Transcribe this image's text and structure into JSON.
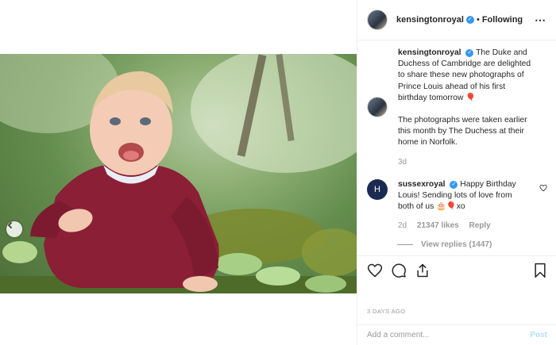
{
  "header": {
    "username": "kensingtonroyal",
    "verified_mark": "✓",
    "separator": "•",
    "follow_state": "Following",
    "more_label": "⋯"
  },
  "caption": {
    "username": "kensingtonroyal",
    "text1": "The Duke and Duchess of Cambridge are delighted to share these new photographs of Prince Louis ahead of his first birthday tomorrow",
    "emoji1": "🎈",
    "text2": "The photographs were taken earlier this month by The Duchess at their home in Norfolk.",
    "age": "3d"
  },
  "reply": {
    "username": "sussexroyal",
    "avatar_letter": "H",
    "text": "Happy Birthday Louis! Sending lots of love from both of us",
    "emoji": "🎂🎈",
    "suffix": "xo",
    "age": "2d",
    "likes": "21347 likes",
    "reply_label": "Reply",
    "view_replies": "View replies (1447)"
  },
  "actions": {
    "like_icon": "heart-icon",
    "comment_icon": "comment-icon",
    "share_icon": "share-icon",
    "save_icon": "bookmark-icon"
  },
  "date_ago": "3 DAYS AGO",
  "add_comment": {
    "placeholder": "Add a comment...",
    "post_label": "Post"
  },
  "colors": {
    "verified": "#3897f0",
    "muted": "#999999",
    "post_disabled": "#b2dffc",
    "border": "#efefef"
  }
}
